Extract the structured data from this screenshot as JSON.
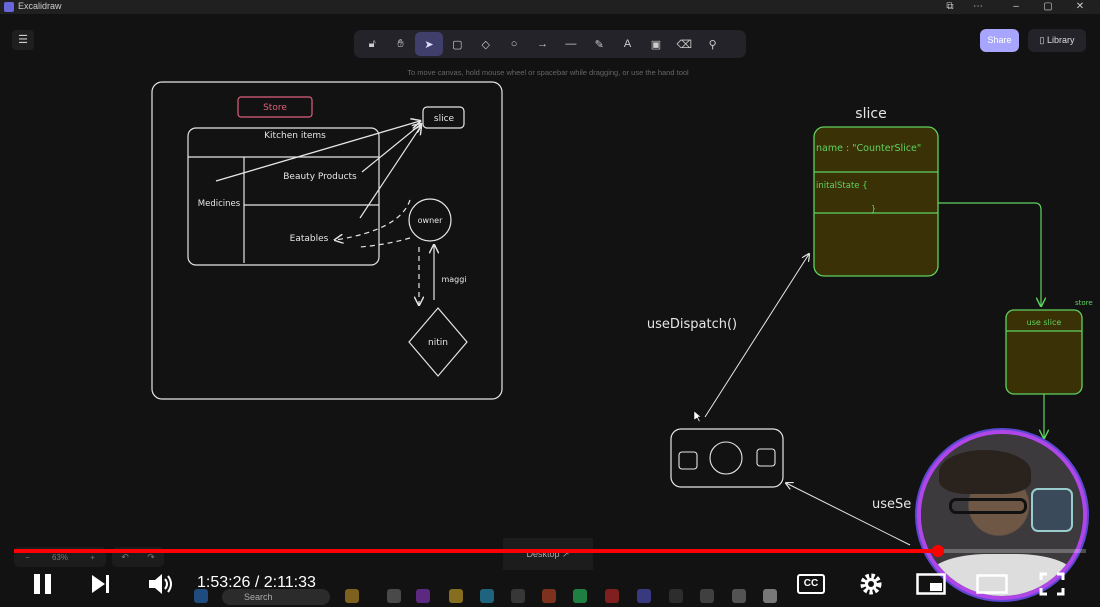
{
  "window": {
    "title": "Excalidraw"
  },
  "toolbar": {
    "tools": [
      {
        "name": "lock",
        "glyph": "🔓︎",
        "key": ""
      },
      {
        "name": "hand",
        "glyph": "✋︎",
        "key": ""
      },
      {
        "name": "selection",
        "glyph": "➤",
        "key": "1"
      },
      {
        "name": "rectangle",
        "glyph": "▢",
        "key": "2"
      },
      {
        "name": "diamond",
        "glyph": "◇",
        "key": "3"
      },
      {
        "name": "ellipse",
        "glyph": "○",
        "key": "4"
      },
      {
        "name": "arrow",
        "glyph": "→",
        "key": "5"
      },
      {
        "name": "line",
        "glyph": "—",
        "key": "6"
      },
      {
        "name": "draw",
        "glyph": "✎",
        "key": "7"
      },
      {
        "name": "text",
        "glyph": "A",
        "key": "8"
      },
      {
        "name": "image",
        "glyph": "▣",
        "key": "9"
      },
      {
        "name": "eraser",
        "glyph": "⌫",
        "key": "0"
      },
      {
        "name": "more-tools",
        "glyph": "⚲",
        "key": ""
      }
    ],
    "hint": "To move canvas, hold mouse wheel or spacebar while dragging, or use the hand tool",
    "share_label": "Share",
    "library_label": "Library"
  },
  "diagram": {
    "store_label": "Store",
    "slice_label": "slice",
    "table_header": "Kitchen items",
    "row_beauty": "Beauty Products",
    "row_medicines": "Medicines",
    "row_eatables": "Eatables",
    "owner_label": "owner",
    "maggi_label": "maggi",
    "nitin_label": "nitin",
    "slice_title": "slice",
    "slice_name_line": "name : \"CounterSlice\"",
    "slice_initial_line": "initalState {",
    "slice_close": "}",
    "use_dispatch": "useDispatch()",
    "use_slice": "use slice",
    "use_selector_partial": "useSe",
    "store_partial": "store"
  },
  "bottom": {
    "zoom_level": "63%",
    "desktop_label": "Desktop ↗"
  },
  "player": {
    "current_time": "1:53:26",
    "duration": "2:11:33",
    "time_display": "1:53:26 / 2:11:33",
    "progress": 0.862,
    "cc_label": "CC"
  },
  "taskbar": {
    "search_label": "Search"
  },
  "colors": {
    "accent": "#6965db",
    "share": "#a8a5ff",
    "progress": "#ff0000",
    "store_border": "#e0607e",
    "slice_green": "#5fd35f",
    "slice_fill": "#3a3106"
  }
}
